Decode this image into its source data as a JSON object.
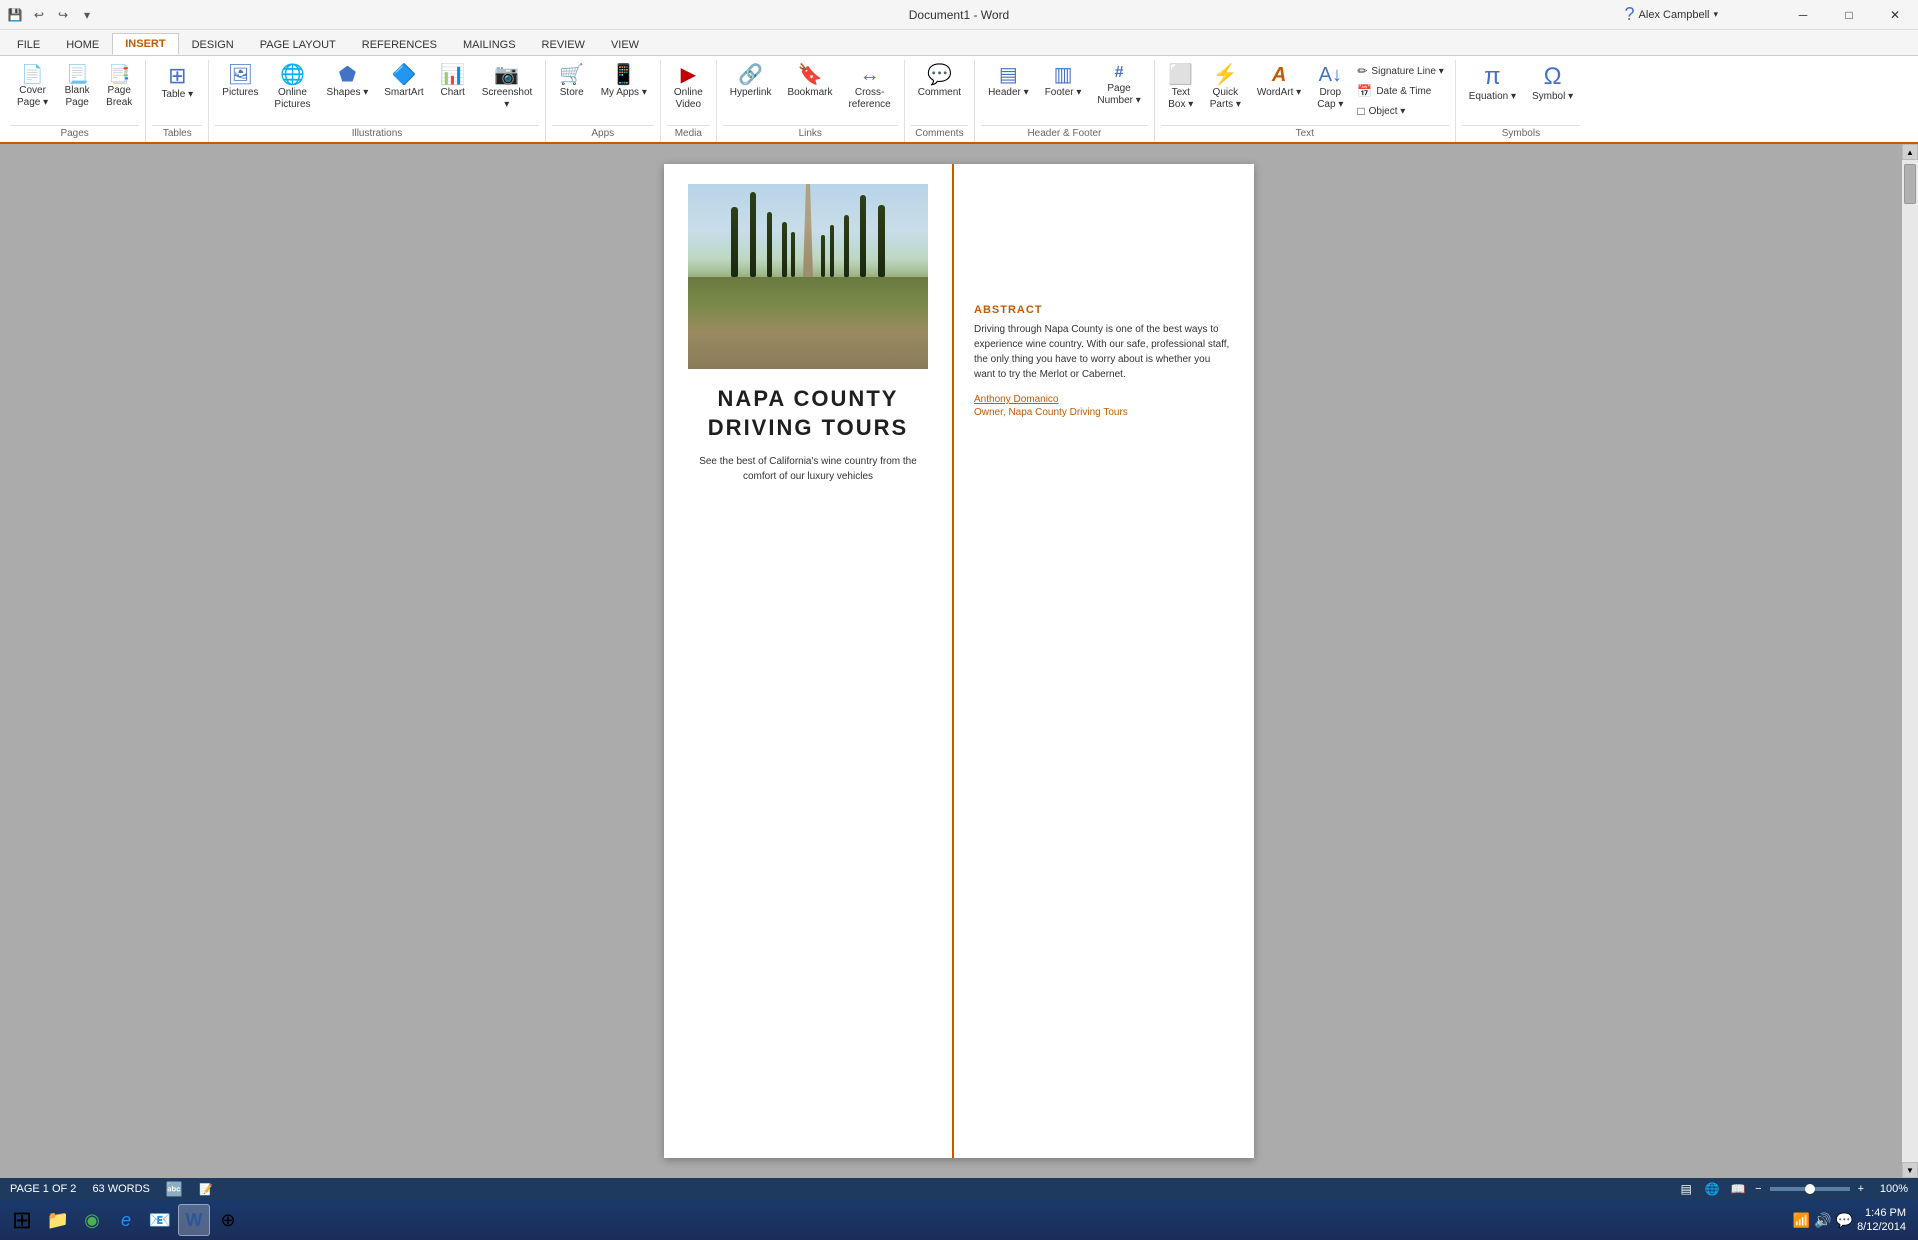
{
  "titlebar": {
    "title": "Document1 - Word",
    "min_label": "─",
    "max_label": "□",
    "close_label": "✕"
  },
  "quickaccess": {
    "save_label": "💾",
    "undo_label": "↩",
    "redo_label": "↪",
    "customize_label": "▾"
  },
  "user": {
    "name": "Alex Campbell",
    "dropdown": "▾"
  },
  "tabs": [
    {
      "id": "file",
      "label": "FILE"
    },
    {
      "id": "home",
      "label": "HOME"
    },
    {
      "id": "insert",
      "label": "INSERT"
    },
    {
      "id": "design",
      "label": "DESIGN"
    },
    {
      "id": "page_layout",
      "label": "PAGE LAYOUT"
    },
    {
      "id": "references",
      "label": "REFERENCES"
    },
    {
      "id": "mailings",
      "label": "MAILINGS"
    },
    {
      "id": "review",
      "label": "REVIEW"
    },
    {
      "id": "view",
      "label": "VIEW"
    }
  ],
  "ribbon": {
    "groups": {
      "pages": {
        "label": "Pages",
        "buttons": [
          {
            "id": "cover-page",
            "icon": "📄",
            "label": "Cover\nPage ▾"
          },
          {
            "id": "blank-page",
            "icon": "📃",
            "label": "Blank\nPage"
          },
          {
            "id": "page-break",
            "icon": "📑",
            "label": "Page\nBreak"
          }
        ]
      },
      "tables": {
        "label": "Tables",
        "buttons": [
          {
            "id": "table",
            "icon": "⊞",
            "label": "Table ▾"
          }
        ]
      },
      "illustrations": {
        "label": "Illustrations",
        "buttons": [
          {
            "id": "pictures",
            "icon": "🖼",
            "label": "Pictures"
          },
          {
            "id": "online-pictures",
            "icon": "🌐",
            "label": "Online\nPictures"
          },
          {
            "id": "shapes",
            "icon": "⬟",
            "label": "Shapes ▾"
          },
          {
            "id": "smartart",
            "icon": "📊",
            "label": "SmartArt"
          },
          {
            "id": "chart",
            "icon": "📈",
            "label": "Chart"
          },
          {
            "id": "screenshot",
            "icon": "📷",
            "label": "Screenshot ▾"
          }
        ]
      },
      "apps": {
        "label": "Apps",
        "buttons": [
          {
            "id": "store",
            "icon": "🛒",
            "label": "Store"
          },
          {
            "id": "my-apps",
            "icon": "📲",
            "label": "My Apps ▾"
          }
        ]
      },
      "media": {
        "label": "Media",
        "buttons": [
          {
            "id": "online-video",
            "icon": "▶",
            "label": "Online\nVideo"
          }
        ]
      },
      "links": {
        "label": "Links",
        "buttons": [
          {
            "id": "hyperlink",
            "icon": "🔗",
            "label": "Hyperlink"
          },
          {
            "id": "bookmark",
            "icon": "🔖",
            "label": "Bookmark"
          },
          {
            "id": "cross-reference",
            "icon": "↔",
            "label": "Cross-\nreference"
          }
        ]
      },
      "comments": {
        "label": "Comments",
        "buttons": [
          {
            "id": "comment",
            "icon": "💬",
            "label": "Comment"
          }
        ]
      },
      "header_footer": {
        "label": "Header & Footer",
        "buttons": [
          {
            "id": "header",
            "icon": "▤",
            "label": "Header ▾"
          },
          {
            "id": "footer",
            "icon": "▥",
            "label": "Footer ▾"
          },
          {
            "id": "page-number",
            "icon": "#",
            "label": "Page\nNumber ▾"
          }
        ]
      },
      "text": {
        "label": "Text",
        "buttons": [
          {
            "id": "text-box",
            "icon": "⬜",
            "label": "Text\nBox ▾"
          },
          {
            "id": "quick-parts",
            "icon": "⚡",
            "label": "Quick\nParts ▾"
          },
          {
            "id": "wordart",
            "icon": "A",
            "label": "WordArt ▾"
          },
          {
            "id": "drop-cap",
            "icon": "A↓",
            "label": "Drop\nCap ▾"
          }
        ],
        "small_items": [
          {
            "id": "signature-line",
            "icon": "✏",
            "label": "Signature Line ▾"
          },
          {
            "id": "date-time",
            "icon": "📅",
            "label": "Date & Time"
          },
          {
            "id": "object",
            "icon": "□",
            "label": "Object ▾"
          }
        ]
      },
      "symbols": {
        "label": "Symbols",
        "buttons": [
          {
            "id": "equation",
            "icon": "π",
            "label": "Equation ▾"
          },
          {
            "id": "symbol",
            "icon": "Ω",
            "label": "Symbol ▾"
          }
        ]
      }
    }
  },
  "document": {
    "title_line1": "NAPA COUNTY",
    "title_line2": "DRIVING TOURS",
    "subtitle": "See the best of California's wine country from the\ncomfort of our luxury vehicles",
    "abstract_label": "ABSTRACT",
    "abstract_text": "Driving through Napa County is one of the best ways to experience wine country. With our safe, professional staff, the only thing you have to worry about is whether you want to try the Merlot or Cabernet.",
    "author_name": "Anthony Domanico",
    "author_title": "Owner, Napa County Driving Tours"
  },
  "statusbar": {
    "page_info": "PAGE 1 OF 2",
    "word_count": "63 WORDS",
    "view_normal": "▤",
    "view_web": "🌐",
    "view_read": "📖",
    "zoom_out": "−",
    "zoom_in": "+",
    "zoom_level": "100%"
  },
  "taskbar": {
    "start_icon": "⊞",
    "time": "1:46 PM",
    "date": "8/12/2014",
    "apps": [
      {
        "id": "explorer",
        "icon": "📁",
        "label": "File Explorer"
      },
      {
        "id": "chrome",
        "icon": "◉",
        "label": "Chrome"
      },
      {
        "id": "ie",
        "icon": "ℯ",
        "label": "Internet Explorer"
      },
      {
        "id": "outlook",
        "icon": "📧",
        "label": "Outlook"
      },
      {
        "id": "word",
        "icon": "W",
        "label": "Word",
        "active": true
      },
      {
        "id": "misc",
        "icon": "⊕",
        "label": "Misc"
      }
    ]
  }
}
